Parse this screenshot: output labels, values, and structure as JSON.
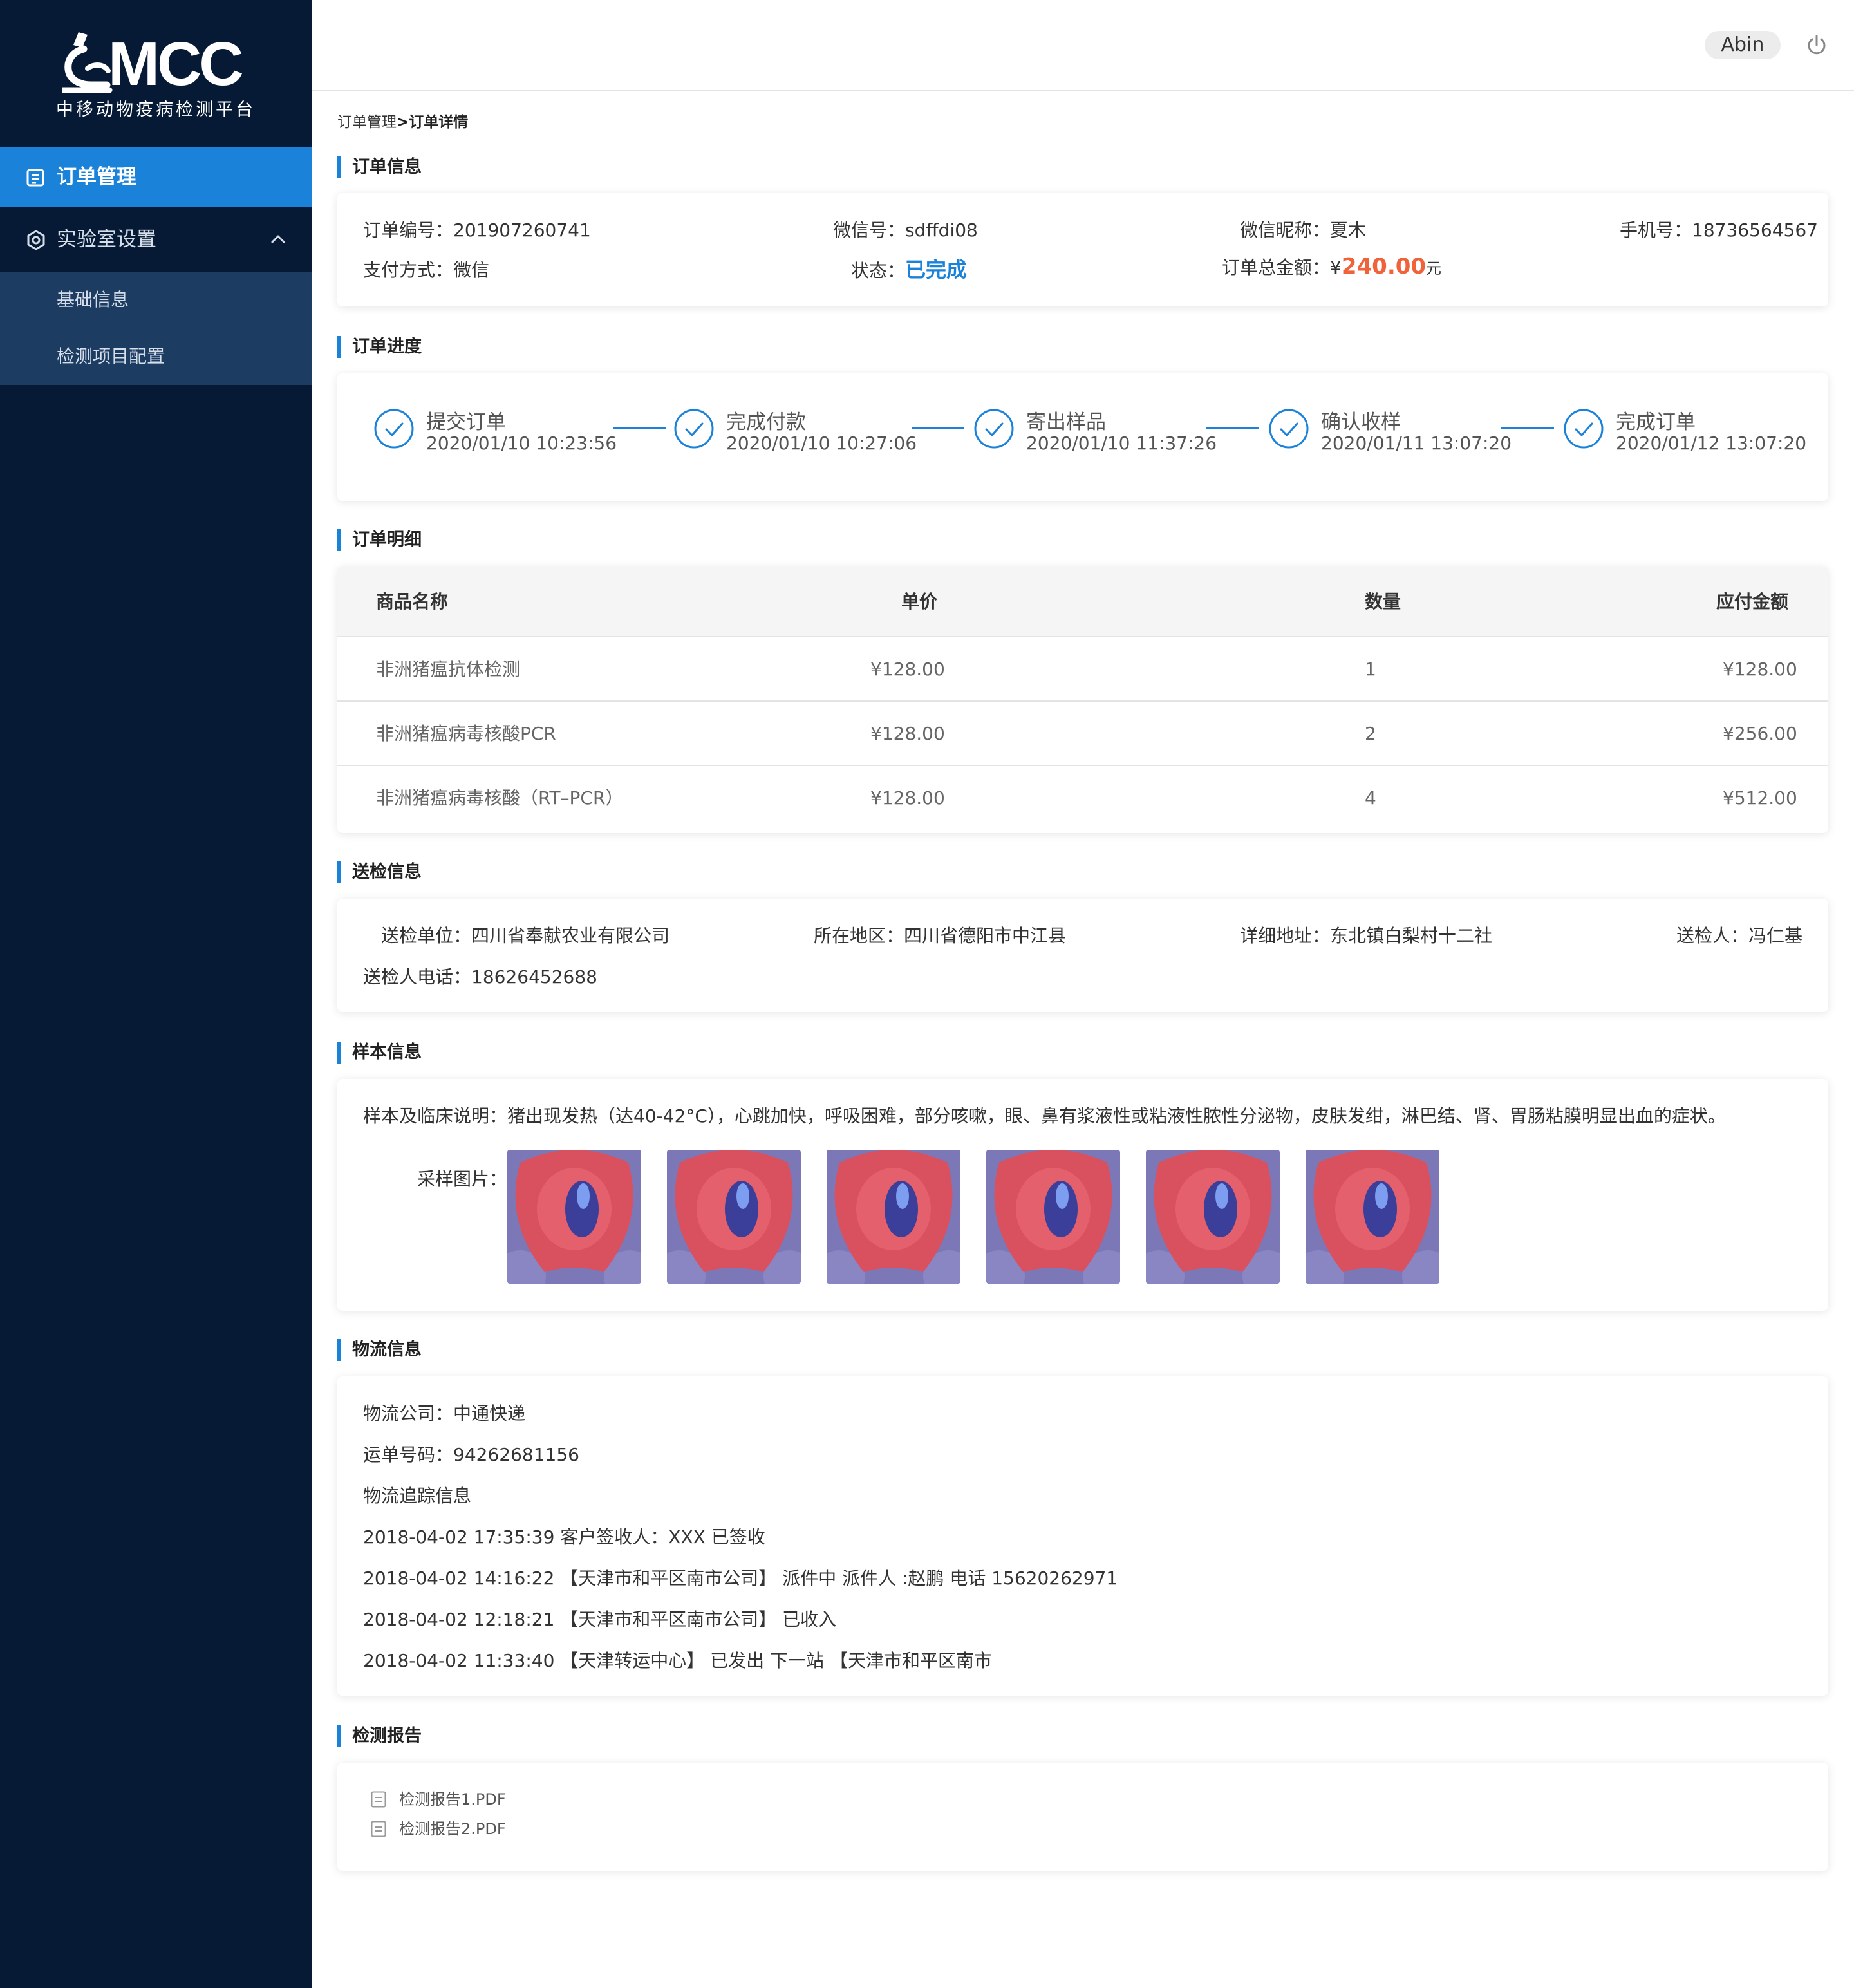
{
  "sidebar": {
    "logo_text": "MCC",
    "platform_name": "中移动物疫病检测平台",
    "active_item": "订单管理",
    "group_label": "实验室设置",
    "sub_items": [
      "基础信息",
      "检测项目配置"
    ]
  },
  "header": {
    "user": "Abin"
  },
  "breadcrumb": {
    "parent": "订单管理",
    "separator": ">",
    "current": "订单详情"
  },
  "order_info": {
    "title": "订单信息",
    "order_no_label": "订单编号：",
    "order_no": "201907260741",
    "wechat_label": "微信号：",
    "wechat": "sdffdi08",
    "nickname_label": "微信昵称：",
    "nickname": "夏木",
    "phone_label": "手机号：",
    "phone": "18736564567",
    "pay_label": "支付方式：",
    "pay": "微信",
    "status_label": "状态：",
    "status": "已完成",
    "total_label": "订单总金额：",
    "currency": "¥",
    "total": "240.00",
    "unit": "元"
  },
  "progress": {
    "title": "订单进度",
    "steps": [
      {
        "name": "提交订单",
        "time": "2020/01/10 10:23:56"
      },
      {
        "name": "完成付款",
        "time": "2020/01/10 10:27:06"
      },
      {
        "name": "寄出样品",
        "time": "2020/01/10 11:37:26"
      },
      {
        "name": "确认收样",
        "time": "2020/01/11 13:07:20"
      },
      {
        "name": "完成订单",
        "time": "2020/01/12 13:07:20"
      }
    ]
  },
  "details": {
    "title": "订单明细",
    "columns": [
      "商品名称",
      "单价",
      "数量",
      "应付金额"
    ],
    "rows": [
      {
        "name": "非洲猪瘟抗体检测",
        "price": "¥128.00",
        "qty": "1",
        "amount": "¥128.00"
      },
      {
        "name": "非洲猪瘟病毒核酸PCR",
        "price": "¥128.00",
        "qty": "2",
        "amount": "¥256.00"
      },
      {
        "name": "非洲猪瘟病毒核酸（RT–PCR）",
        "price": "¥128.00",
        "qty": "4",
        "amount": "¥512.00"
      }
    ]
  },
  "submission": {
    "title": "送检信息",
    "unit_label": "送检单位：",
    "unit": "四川省奉献农业有限公司",
    "region_label": "所在地区：",
    "region": "四川省德阳市中江县",
    "address_label": "详细地址：",
    "address": "东北镇白梨村十二社",
    "person_label": "送检人：",
    "person": "冯仁基",
    "person_phone_label": "送检人电话：",
    "person_phone": "18626452688"
  },
  "sample": {
    "title": "样本信息",
    "desc_label": "样本及临床说明：",
    "desc": "猪出现发热（达40-42°C），心跳加快，呼吸困难，部分咳嗽，眼、鼻有浆液性或粘液性脓性分泌物，皮肤发绀，淋巴结、肾、胃肠粘膜明显出血的症状。",
    "images_label": "采样图片：",
    "image_count": 6
  },
  "logistics": {
    "title": "物流信息",
    "company_label": "物流公司：",
    "company": "中通快递",
    "waybill_label": "运单号码：",
    "waybill": "94262681156",
    "tracking_label": "物流追踪信息",
    "tracking": [
      "2018-04-02 17:35:39 客户签收人：XXX 已签收",
      "2018-04-02 14:16:22 【天津市和平区南市公司】 派件中 派件人 :赵鹏 电话 15620262971",
      "2018-04-02 12:18:21 【天津市和平区南市公司】 已收入",
      "2018-04-02 11:33:40 【天津转运中心】 已发出 下一站 【天津市和平区南市"
    ]
  },
  "reports": {
    "title": "检测报告",
    "files": [
      "检测报告1.PDF",
      "检测报告2.PDF"
    ]
  },
  "colors": {
    "sidebar_bg": "#061a35",
    "accent": "#1a82d8",
    "sub_nav_bg": "#1d3c62",
    "price_red": "#f06239"
  }
}
